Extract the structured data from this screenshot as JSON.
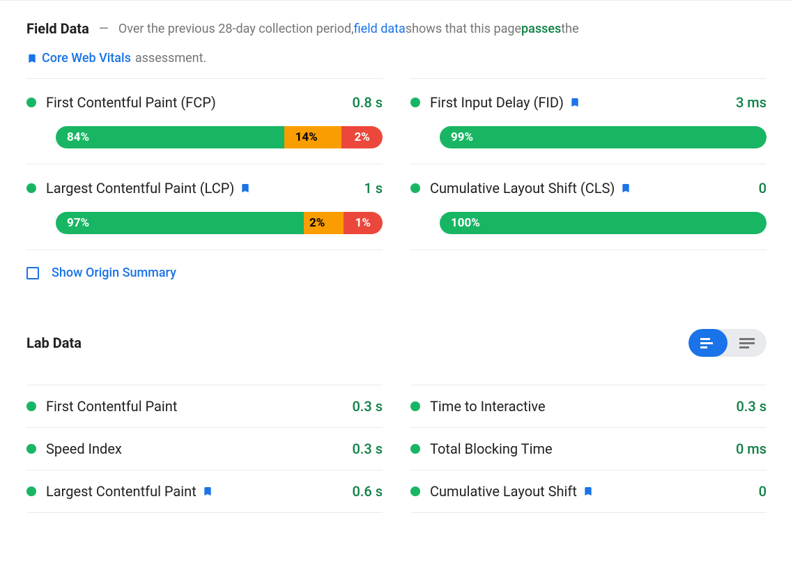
{
  "fieldData": {
    "title": "Field Data",
    "introPre": "Over the previous 28-day collection period, ",
    "fieldDataLink": "field data",
    "introMid": " shows that this page ",
    "passes": "passes",
    "introPost": " the",
    "cwvLink": "Core Web Vitals",
    "assessment": " assessment.",
    "metrics": [
      {
        "name": "First Contentful Paint (FCP)",
        "value": "0.8 s",
        "bookmark": false,
        "distribution": {
          "good": "84%",
          "ok": "14%",
          "poor": "2%"
        }
      },
      {
        "name": "First Input Delay (FID)",
        "value": "3 ms",
        "bookmark": true,
        "distribution": {
          "good": "99%",
          "ok": "",
          "poor": ""
        }
      },
      {
        "name": "Largest Contentful Paint (LCP)",
        "value": "1 s",
        "bookmark": true,
        "distribution": {
          "good": "97%",
          "ok": "2%",
          "poor": "1%"
        }
      },
      {
        "name": "Cumulative Layout Shift (CLS)",
        "value": "0",
        "bookmark": true,
        "distribution": {
          "good": "100%",
          "ok": "",
          "poor": ""
        }
      }
    ],
    "originSummary": "Show Origin Summary"
  },
  "labData": {
    "title": "Lab Data",
    "metrics": [
      {
        "name": "First Contentful Paint",
        "value": "0.3 s",
        "bookmark": false
      },
      {
        "name": "Time to Interactive",
        "value": "0.3 s",
        "bookmark": false
      },
      {
        "name": "Speed Index",
        "value": "0.3 s",
        "bookmark": false
      },
      {
        "name": "Total Blocking Time",
        "value": "0 ms",
        "bookmark": false
      },
      {
        "name": "Largest Contentful Paint",
        "value": "0.6 s",
        "bookmark": true
      },
      {
        "name": "Cumulative Layout Shift",
        "value": "0",
        "bookmark": true
      }
    ]
  },
  "colors": {
    "green": "#18b663",
    "orange": "#fa9d00",
    "red": "#eb483b",
    "blue": "#1a73e8"
  }
}
